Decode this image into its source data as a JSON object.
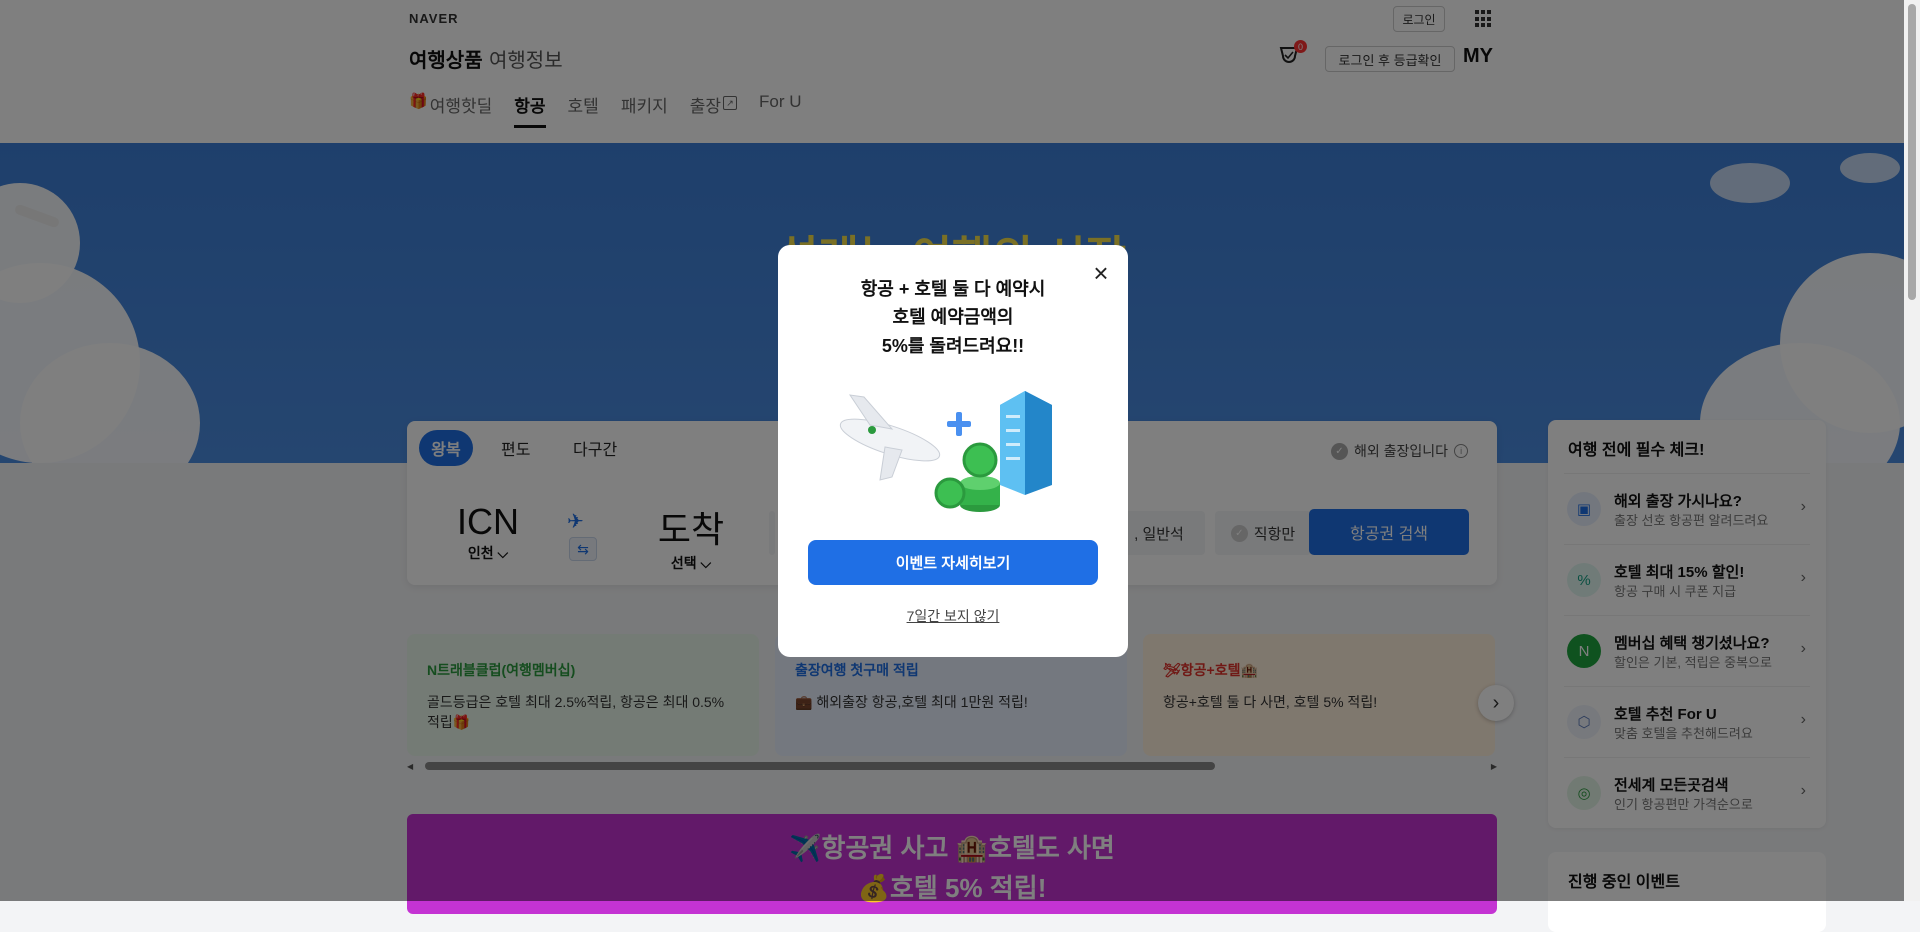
{
  "header": {
    "brand": "NAVER",
    "login_label": "로그인",
    "title_main": "여행상품",
    "title_sub": "여행정보",
    "trophy_count": "0",
    "grade_check_label": "로그인 후 등급확인",
    "my_label": "MY"
  },
  "tabs": [
    {
      "label": "여행핫딜",
      "active": false
    },
    {
      "label": "항공",
      "active": true
    },
    {
      "label": "호텔",
      "active": false
    },
    {
      "label": "패키지",
      "active": false
    },
    {
      "label": "출장",
      "active": false
    },
    {
      "label": "For U",
      "active": false
    }
  ],
  "hero": {
    "title": "설레는 여행의 시작"
  },
  "search": {
    "trip_types": [
      "왕복",
      "편도",
      "다구간"
    ],
    "abroad_label": "해외 출장입니다",
    "origin_code": "ICN",
    "origin_name": "인천",
    "dest_code": "도착",
    "dest_name": "선택",
    "seat_label": ", 일반석",
    "direct_label": "직항만",
    "search_button": "항공권 검색"
  },
  "promo_cards": [
    {
      "title": "N트래블클럽(여행멤버십)",
      "desc": "골드등급은 호텔 최대 2.5%적립, 항공은 최대 0.5% 적립🎁",
      "color": "#2b9a3e"
    },
    {
      "title": "출장여행 첫구매 적립",
      "desc": "💼 해외출장 항공,호텔 최대 1만원 적립!",
      "color": "#1f6fe5"
    },
    {
      "title": "🛩항공+호텔🏨",
      "desc": "항공+호텔 둘 다 사면, 호텔 5% 적립!",
      "color": "#e0312b"
    }
  ],
  "banner": {
    "line1": "✈️항공권 사고 🏨호텔도 사면",
    "line2": "💰호텔 5% 적립!"
  },
  "sidebar": {
    "heading": "여행 전에 필수 체크!",
    "items": [
      {
        "title": "해외 출장 가시나요?",
        "desc": "출장 선호 항공편 알려드려요",
        "icon": "briefcase-icon"
      },
      {
        "title": "호텔 최대 15% 할인!",
        "desc": "항공 구매 시 쿠폰 지급",
        "icon": "percent-icon"
      },
      {
        "title": "멤버십 혜택 챙기셨나요?",
        "desc": "할인은 기본, 적립은 중복으로",
        "icon": "naver-pay-icon"
      },
      {
        "title": "호텔 추천 For U",
        "desc": "맞춤 호텔을 추천해드려요",
        "icon": "cube-icon"
      },
      {
        "title": "전세계 모든곳검색",
        "desc": "인기 항공편만 가격순으로",
        "icon": "globe-search-icon"
      }
    ],
    "events_heading": "진행 중인 이벤트"
  },
  "modal": {
    "line1": "항공 + 호텔 둘 다 예약시",
    "line2": "호텔 예약금액의",
    "line3": "5%를 돌려드려요!!",
    "cta": "이벤트 자세히보기",
    "dismiss": "7일간 보지 않기"
  },
  "colors": {
    "accent": "#1f6fe5",
    "hero_bg": "#3d7fd8",
    "hero_title": "#f5e14a",
    "banner_bg": "#c433d3",
    "overlay": "rgba(0,0,0,0.5)"
  }
}
